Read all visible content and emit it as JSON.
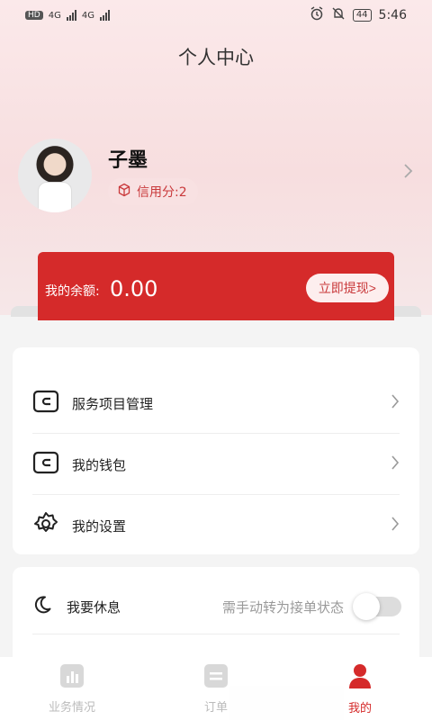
{
  "status_bar": {
    "left_badge": "HD",
    "network_1": "4G",
    "network_2": "4G",
    "battery": "44",
    "time": "5:46"
  },
  "header": {
    "title": "个人中心"
  },
  "profile": {
    "name": "子墨",
    "credit_label": "信用分:2"
  },
  "balance": {
    "label": "我的余额:",
    "value": "0.00",
    "withdraw_button": "立即提现>"
  },
  "menu": {
    "items": [
      {
        "label": "服务项目管理",
        "icon": "wallet-icon"
      },
      {
        "label": "我的钱包",
        "icon": "wallet-icon"
      },
      {
        "label": "我的设置",
        "icon": "gear-icon"
      }
    ]
  },
  "rest": {
    "label": "我要休息",
    "hint": "需手动转为接单状态",
    "toggle_on": false,
    "icon": "moon-icon"
  },
  "tabbar": {
    "tabs": [
      {
        "label": "业务情况",
        "icon": "chart-icon",
        "active": false
      },
      {
        "label": "订单",
        "icon": "order-icon",
        "active": false
      },
      {
        "label": "我的",
        "icon": "user-icon",
        "active": true
      }
    ]
  },
  "colors": {
    "accent": "#d52a2a",
    "credit_bg": "#f8e1e2"
  }
}
